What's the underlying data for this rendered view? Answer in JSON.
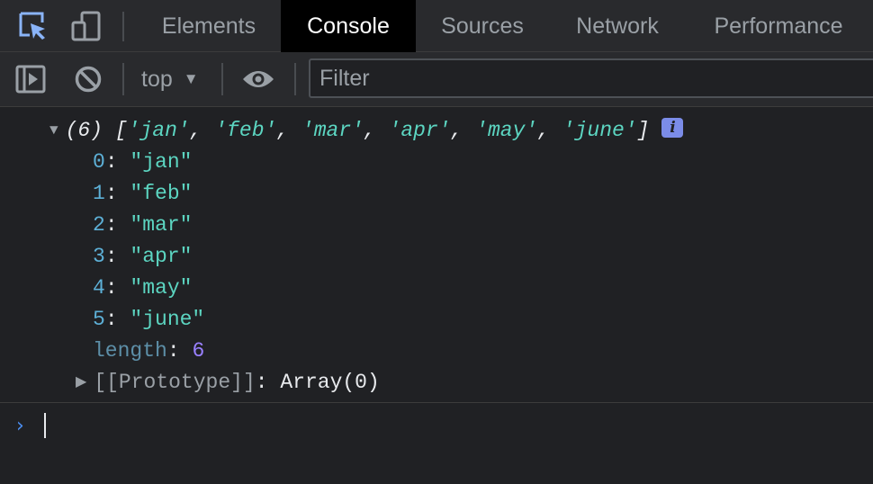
{
  "tabs": [
    {
      "label": "Elements"
    },
    {
      "label": "Console"
    },
    {
      "label": "Sources"
    },
    {
      "label": "Network"
    },
    {
      "label": "Performance"
    }
  ],
  "toolbar": {
    "context": "top",
    "filter_placeholder": "Filter"
  },
  "console": {
    "summary": {
      "count": "(6)",
      "items": [
        "'jan'",
        "'feb'",
        "'mar'",
        "'apr'",
        "'may'",
        "'june'"
      ]
    },
    "entries": [
      {
        "key": "0",
        "value": "\"jan\""
      },
      {
        "key": "1",
        "value": "\"feb\""
      },
      {
        "key": "2",
        "value": "\"mar\""
      },
      {
        "key": "3",
        "value": "\"apr\""
      },
      {
        "key": "4",
        "value": "\"may\""
      },
      {
        "key": "5",
        "value": "\"june\""
      }
    ],
    "length": {
      "key": "length",
      "value": "6"
    },
    "prototype": {
      "key": "[[Prototype]]",
      "value": "Array(0)"
    },
    "info_badge": "i"
  },
  "colors": {
    "string": "#5cd5c1",
    "key": "#5db0d7",
    "number": "#9980ff",
    "prompt": "#4b8ef1",
    "inspect_icon": "#8ab4f8"
  },
  "icons": {
    "inspect": "inspect-element-icon",
    "device": "device-toolbar-icon",
    "sidebar": "show-sidebar-icon",
    "clear": "clear-console-icon",
    "eye": "live-expression-icon",
    "prompt": "prompt-chevron-icon"
  }
}
